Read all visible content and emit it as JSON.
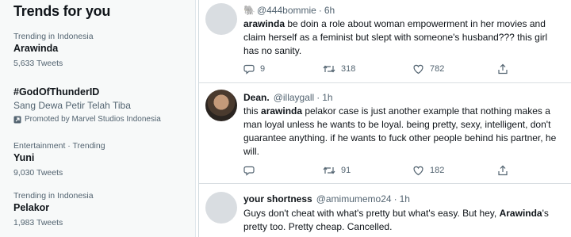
{
  "trends": {
    "title": "Trends for you",
    "items": [
      {
        "meta": "Trending in Indonesia",
        "name": "Arawinda",
        "count": "5,633 Tweets"
      },
      {
        "name": "#GodOfThunderID",
        "subtitle": "Sang Dewa Petir Telah Tiba",
        "promo": "Promoted by Marvel Studios Indonesia"
      },
      {
        "meta": "Entertainment · Trending",
        "name": "Yuni",
        "count": "9,030 Tweets"
      },
      {
        "meta": "Trending in Indonesia",
        "name": "Pelakor",
        "count": "1,983 Tweets"
      }
    ]
  },
  "tweets": [
    {
      "display_name": "",
      "handle_icon": "elephant-emoji",
      "handle": "@444bommie",
      "dot": "·",
      "time": "6h",
      "bold_prefix": "arawinda",
      "text": " be doin a role about woman empowerment in her movies and claim herself as a feminist but slept with someone's husband??? this girl has no sanity.",
      "replies": "9",
      "retweets": "318",
      "likes": "782"
    },
    {
      "display_name": "Dean.",
      "handle": "@illaygall",
      "dot": "·",
      "time": "1h",
      "text_before": "this ",
      "bold_mid": "arawinda",
      "text_after": " pelakor case is just another example that nothing makes a man loyal unless he wants to be loyal. being pretty, sexy, intelligent, don't guarantee anything. if he wants to fuck other people behind his partner, he will.",
      "replies": "",
      "retweets": "91",
      "likes": "182"
    },
    {
      "display_name": "your shortness",
      "handle": "@amimumemo24",
      "dot": "·",
      "time": "1h",
      "text_before": "Guys don't cheat with what's pretty but what's easy. But hey, ",
      "bold_mid": "Arawinda",
      "text_after": "'s pretty too. Pretty cheap. Cancelled."
    }
  ],
  "colors": {
    "text": "#0f1419",
    "secondary": "#536471",
    "panel": "#f7f9f9"
  }
}
